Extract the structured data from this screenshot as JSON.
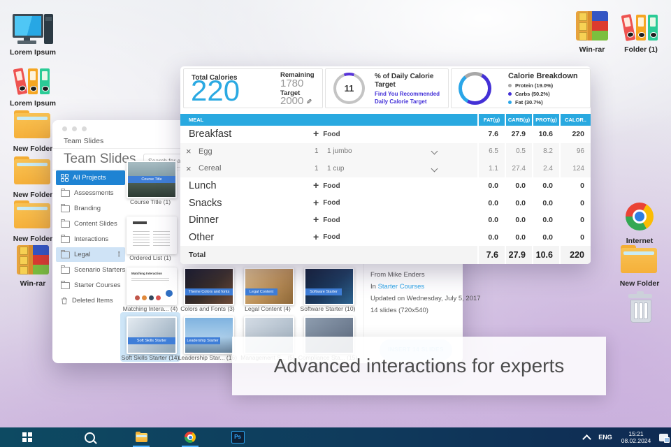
{
  "desktop": {
    "left_icons": [
      {
        "label": "Lorem Ipsum"
      },
      {
        "label": "Lorem Ipsum"
      },
      {
        "label": "New Folder"
      },
      {
        "label": "New Folder"
      },
      {
        "label": "New Folder"
      },
      {
        "label": "Win-rar"
      }
    ],
    "right_icons": [
      {
        "label": "Win-rar"
      },
      {
        "label": "Folder (1)"
      },
      {
        "label": "Internet"
      },
      {
        "label": "New Folder"
      }
    ]
  },
  "slides_app": {
    "window_title": "Team Slides",
    "heading": "Team Slides",
    "search_placeholder": "Search for a p",
    "sidebar": [
      {
        "label": "All Projects"
      },
      {
        "label": "Assessments"
      },
      {
        "label": "Branding"
      },
      {
        "label": "Content Slides"
      },
      {
        "label": "Interactions"
      },
      {
        "label": "Legal"
      },
      {
        "label": "Scenario Starters"
      },
      {
        "label": "Starter Courses"
      },
      {
        "label": "Deleted Items"
      }
    ],
    "thumbnails": [
      {
        "label": "Course Title (1)",
        "overlay": "Course Title"
      },
      {
        "label": "Ordered List (1)"
      },
      {
        "label": "Matching Intera... (4)",
        "overlay": "Matching Interaction"
      },
      {
        "label": "Colors and Fonts (3)",
        "overlay": "Theme Colors and fonts"
      },
      {
        "label": "Legal Content (4)",
        "overlay": "Legal Content"
      },
      {
        "label": "Software Starter (10)",
        "overlay": "Software Starter"
      },
      {
        "label": "Soft Skills Starter (14)",
        "overlay": "Soft Skills Starter"
      },
      {
        "label": "Leadership Star... (16)",
        "overlay": "Leadership Starter"
      },
      {
        "label": "Management S... (5)"
      },
      {
        "label": "Compliance Sta... (15)"
      }
    ],
    "details": {
      "from": "From Mike Enders",
      "in_prefix": "In",
      "in_link": "Starter Courses",
      "updated": "Updated on Wednesday, July 5, 2017",
      "slides_info": "14 slides (720x540)",
      "insert_button": "INSERT 14 SLIDES"
    }
  },
  "calorie_app": {
    "summary": {
      "total_label": "Total Calories",
      "total_value": "220",
      "remaining_label": "Remaining",
      "remaining_value": "1780",
      "target_label": "Target",
      "target_value": "2000",
      "gauge_value": "11",
      "gauge_title": "% of Daily Calorie Target",
      "gauge_link_line1": "Find You Recommended",
      "gauge_link_line2": "Daily Calorie Target",
      "breakdown_title": "Calorie Breakdown",
      "legend": [
        {
          "label": "Protein (19.0%)",
          "color": "#a8a8a8"
        },
        {
          "label": "Carbs (50.2%)",
          "color": "#4330d6"
        },
        {
          "label": "Fat (30.7%)",
          "color": "#2aa6e8"
        }
      ]
    },
    "table": {
      "columns": [
        "MEAL",
        "FAT(g)",
        "CARB(g)",
        "PROT(g)",
        "CALOR.."
      ],
      "rows": [
        {
          "name": "Breakfast",
          "add": "Food",
          "fat": "7.6",
          "carb": "27.9",
          "prot": "10.6",
          "cal": "220"
        },
        {
          "name": "Egg",
          "qty": "1",
          "serving": "1 jumbo",
          "fat": "6.5",
          "carb": "0.5",
          "prot": "8.2",
          "cal": "96"
        },
        {
          "name": "Cereal",
          "qty": "1",
          "serving": "1 cup",
          "fat": "1.1",
          "carb": "27.4",
          "prot": "2.4",
          "cal": "124"
        },
        {
          "name": "Lunch",
          "add": "Food",
          "fat": "0.0",
          "carb": "0.0",
          "prot": "0.0",
          "cal": "0"
        },
        {
          "name": "Snacks",
          "add": "Food",
          "fat": "0.0",
          "carb": "0.0",
          "prot": "0.0",
          "cal": "0"
        },
        {
          "name": "Dinner",
          "add": "Food",
          "fat": "0.0",
          "carb": "0.0",
          "prot": "0.0",
          "cal": "0"
        },
        {
          "name": "Other",
          "add": "Food",
          "fat": "0.0",
          "carb": "0.0",
          "prot": "0.0",
          "cal": "0"
        }
      ],
      "total": {
        "label": "Total",
        "fat": "7.6",
        "carb": "27.9",
        "prot": "10.6",
        "cal": "220"
      }
    }
  },
  "banner": {
    "text": "Advanced interactions for experts"
  },
  "taskbar": {
    "photoshop_label": "Ps",
    "tray_lang": "ENG",
    "tray_time": "15:21",
    "tray_date": "08.02.2024"
  }
}
